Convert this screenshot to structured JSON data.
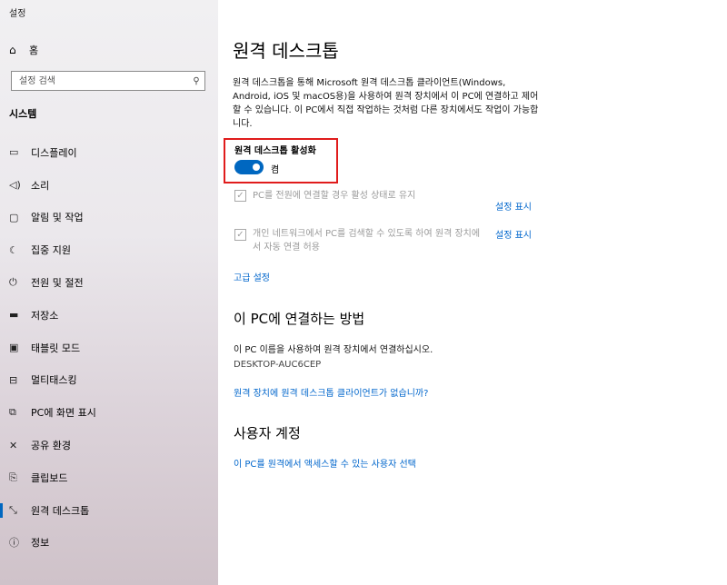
{
  "app": {
    "title": "설정"
  },
  "sidebar": {
    "home_label": "홈",
    "search_placeholder": "설정 검색",
    "section": "시스템",
    "items": [
      {
        "label": "디스플레이",
        "icon": "display-icon"
      },
      {
        "label": "소리",
        "icon": "speaker-icon"
      },
      {
        "label": "알림 및 작업",
        "icon": "notification-icon"
      },
      {
        "label": "집중 지원",
        "icon": "moon-icon"
      },
      {
        "label": "전원 및 절전",
        "icon": "power-icon"
      },
      {
        "label": "저장소",
        "icon": "storage-icon"
      },
      {
        "label": "태블릿 모드",
        "icon": "tablet-icon"
      },
      {
        "label": "멀티태스킹",
        "icon": "multitasking-icon"
      },
      {
        "label": "PC에 화면 표시",
        "icon": "project-icon"
      },
      {
        "label": "공유 환경",
        "icon": "share-icon"
      },
      {
        "label": "클립보드",
        "icon": "clipboard-icon"
      },
      {
        "label": "원격 데스크톱",
        "icon": "remote-desktop-icon",
        "active": true
      },
      {
        "label": "정보",
        "icon": "info-icon"
      }
    ]
  },
  "main": {
    "title": "원격 데스크톱",
    "description": "원격 데스크톱을 통해 Microsoft 원격 데스크톱 클라이언트(Windows, Android, iOS 및 macOS용)을 사용하여 원격 장치에서 이 PC에 연결하고 제어할 수 있습니다. 이 PC에서 직접 작업하는 것처럼 다른 장치에서도 작업이 가능합니다.",
    "enable_label": "원격 데스크톱 활성화",
    "toggle_state": "켬",
    "accent_color": "#0067c0",
    "highlight_color": "#e01c1c",
    "options": [
      {
        "text": "PC를 전원에 연결할 경우 활성 상태로 유지",
        "link": "설정 표시",
        "checked": true
      },
      {
        "text": "개인 네트워크에서 PC를 검색할 수 있도록 하여 원격 장치에서 자동 연결 허용",
        "link": "설정 표시",
        "checked": true
      }
    ],
    "advanced_link": "고급 설정",
    "connect_heading": "이 PC에 연결하는 방법",
    "connect_text": "이 PC 이름을 사용하여 원격 장치에서 연결하십시오.",
    "pc_name": "DESKTOP-AUC6CEP",
    "no_client_link": "원격 장치에 원격 데스크톱 클라이언트가 없습니까?",
    "accounts_heading": "사용자 계정",
    "accounts_link": "이 PC를 원격에서 액세스할 수 있는 사용자 선택"
  }
}
